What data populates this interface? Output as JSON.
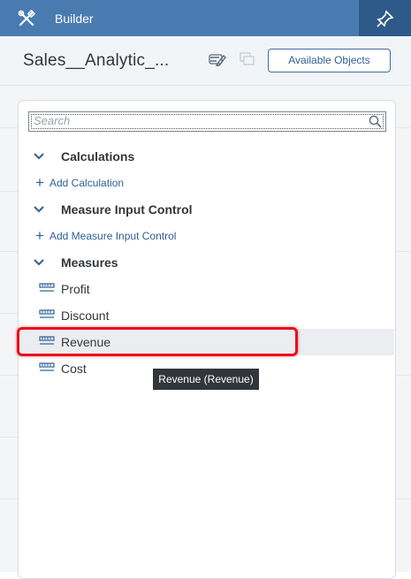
{
  "header": {
    "title": "Builder",
    "tools_icon": "tools-icon",
    "pin_icon": "pin-icon",
    "accent_color": "#4a7bb0"
  },
  "subheader": {
    "model_name": "Sales__Analytic_...",
    "edit_icon": "edit-icon",
    "copy_icon": "copy-icon",
    "available_objects_label": "Available Objects"
  },
  "search": {
    "placeholder": "Search",
    "icon": "search-icon"
  },
  "groups": {
    "calculations": {
      "title": "Calculations",
      "add_label": "Add Calculation"
    },
    "measure_input_control": {
      "title": "Measure Input Control",
      "add_label": "Add Measure Input Control"
    },
    "measures": {
      "title": "Measures",
      "items": [
        "Profit",
        "Discount",
        "Revenue",
        "Cost"
      ],
      "selected": "Revenue"
    }
  },
  "tooltip": {
    "text": "Revenue (Revenue)"
  },
  "highlight_color": "#e8101b"
}
